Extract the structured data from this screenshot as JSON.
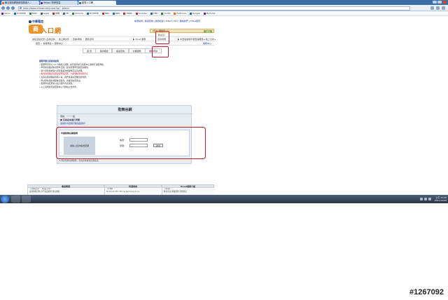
{
  "browser": {
    "tabs": [
      {
        "label": "聯合新聞網與新聞廣場人…"
      },
      {
        "label": "Yahoo! 奇摩首頁"
      },
      {
        "label": "動態入口網"
      }
    ],
    "url": "http://www.chtsecurity.com.tw/...phtml",
    "bookmarks": [
      "Yahoo",
      "PCHOME",
      "MSN",
      "Apple",
      "中時",
      "FB",
      "Chrome",
      "PCHOME",
      "NBA",
      "NBA",
      "HSBC",
      "Youtube",
      "TMD",
      "OurMi",
      "Fullmoon",
      "Google",
      "Myhome"
    ],
    "bookmark_colors": [
      "#6a1b9a",
      "#1565c0",
      "#2e7d32",
      "#555555",
      "#c62828",
      "#3b5998",
      "#2e7d32",
      "#1565c0",
      "#c62828",
      "#1565c0",
      "#c62828",
      "#c62828",
      "#1565c0",
      "#2e7d32",
      "#ef6c00",
      "#1565c0",
      "#6a1b9a"
    ]
  },
  "site": {
    "brand": "中華電信",
    "logo_big": "商",
    "logo_text": "入口網",
    "toplinks": "帳號總覽 | 帳單查詢 | 繳款紀錄 | HiNet | FAQ | 聯絡我們 | HiNet首頁",
    "greeting": "用戶：關鍵字",
    "username": "歡迎您！",
    "logout": "登出",
    "subnav": {
      "left": "請先至設定登入您的資料 ｜ 請上傳文件 ｜ 查詢/申請 ｜ 更新資料",
      "mid": "▶ Hinet 服務",
      "boxed": "合約聲明",
      "right": "▶ 中華電信用戶調查與服務 ▸ 線上付款 ▸"
    },
    "breadcrumb": "首頁 > 會員專區 > 服務中心",
    "breadcrumb_right": "服務中心",
    "tabs": [
      "首 頁",
      "我的帳號",
      "帳單查詢",
      "付費服務",
      "服務申辦"
    ],
    "notes": {
      "title": "服務申辦注意事項說明",
      "items": [
        "服務申辦可以 24 小時線上辦理，如有疑問請洽客服中心或撥打客服專線。",
        "申辦前請確認帳號資料正確，避免影響申辦進度與權益。",
        "個人資料將依個人資料保護法相關規定妥善處理。",
        "帳號啟用後請立即變更預設密碼，以確保帳號使用安全。",
        "如需協助請聯絡客服人員，我們將盡快回覆您的問題。",
        "申請資料送出後即無法更改，請確認後再送出。",
        "服務申辦結果將以電子郵件方式通知。",
        "以上說明如有變更依本公司網站公告為準。"
      ]
    },
    "panel": {
      "title": "勁舞谷網",
      "line1": "申請：一一一般",
      "line2": "■ 目前尚未進行申辦",
      "line3": "適用於市話或行動電話用戶",
      "form_title": "申請勁舞谷網服務",
      "form_label": "請輸入您的帳號密碼",
      "account_label": "帳號：",
      "password_label": "密碼：",
      "submit": "送出",
      "footnote": "※ 申請勁舞谷網服務，需先完成帳號密碼驗證。"
    },
    "footer": {
      "heads": [
        "會員精選",
        "特選商城",
        "Hinet服務介紹"
      ],
      "col1": [
        "【活動訊息】 【新品上市】",
        "最新優惠活動 熱門商品推薦 會員專屬"
      ],
      "col2": [
        "【手機】",
        "Motorola HTC iPhone Samsung Sony"
      ],
      "col3": [
        "【家電】",
        "數位家電 網路服務 雲端資訊"
      ]
    }
  },
  "taskbar": {
    "clock_time": "上午 11:45",
    "clock_date": "2011/12/26"
  },
  "watermark": "#1267092"
}
